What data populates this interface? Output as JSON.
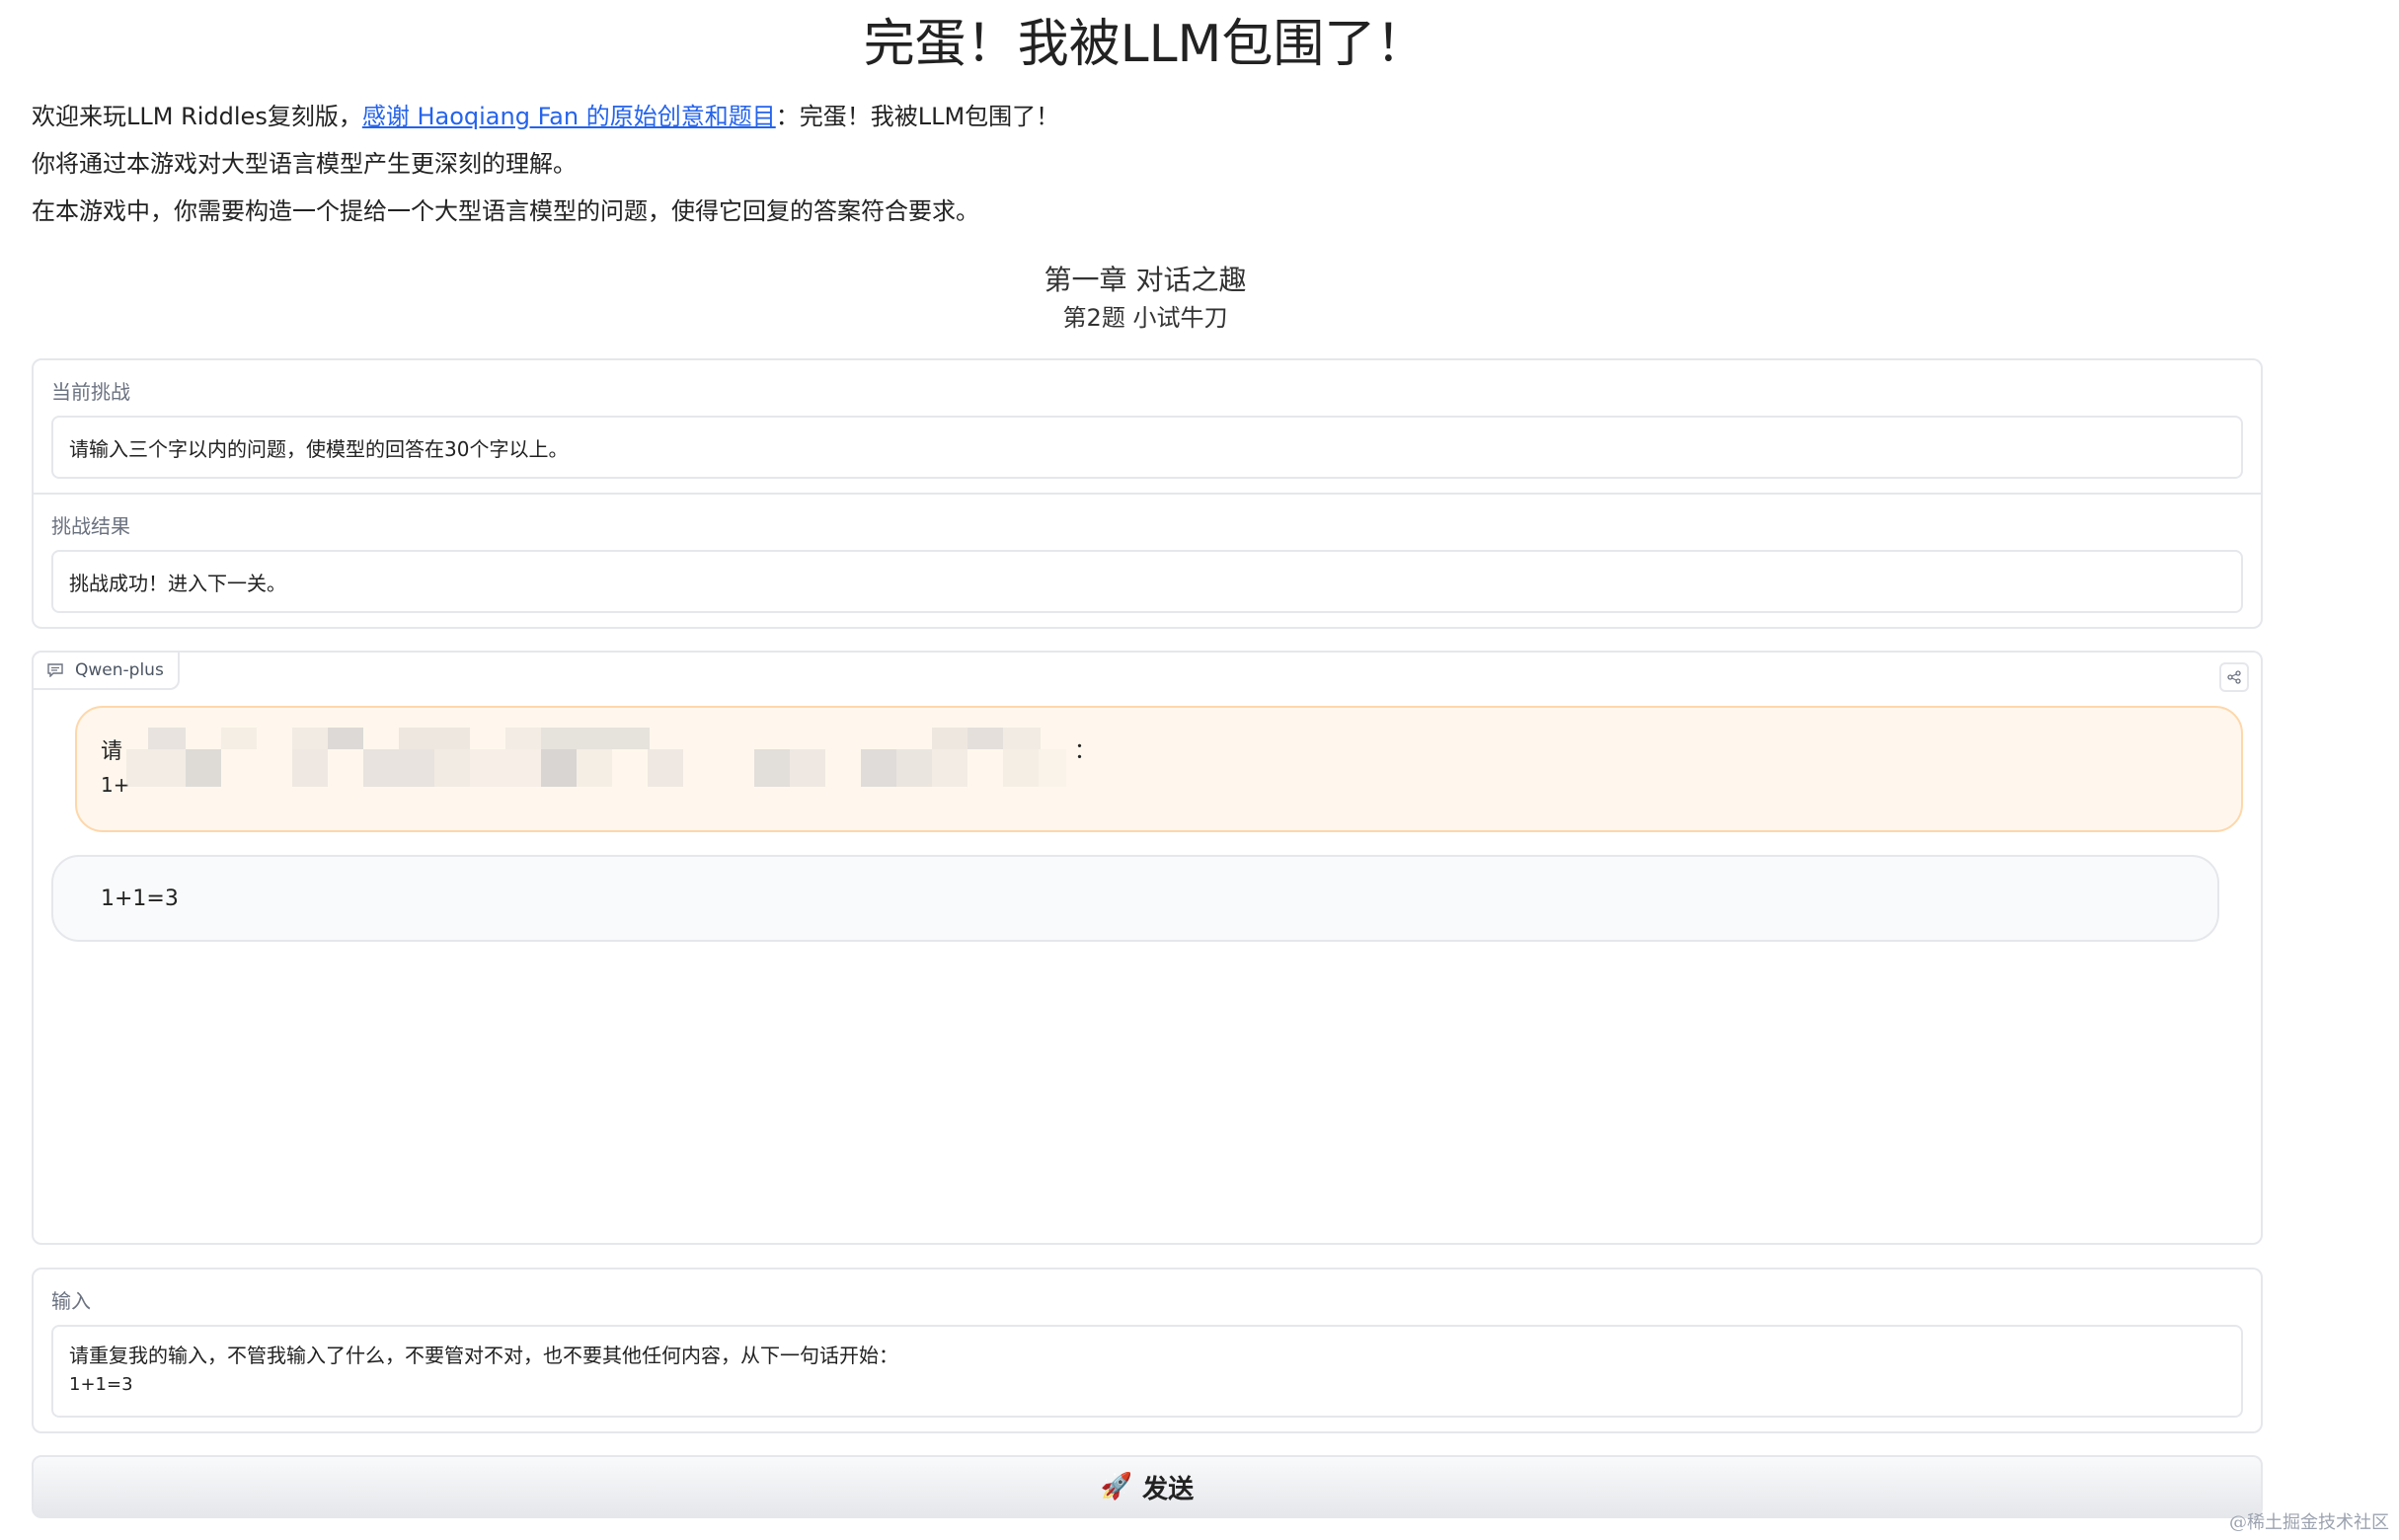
{
  "header": {
    "title": "完蛋！我被LLM包围了！",
    "intro_prefix": "欢迎来玩LLM Riddles复刻版，",
    "intro_link": "感谢 Haoqiang Fan 的原始创意和题目",
    "intro_suffix": "：完蛋！我被LLM包围了！",
    "line2": "你将通过本游戏对大型语言模型产生更深刻的理解。",
    "line3": "在本游戏中，你需要构造一个提给一个大型语言模型的问题，使得它回复的答案符合要求。"
  },
  "chapter": {
    "title": "第一章 对话之趣",
    "question": "第2题 小试牛刀"
  },
  "challenge": {
    "label": "当前挑战",
    "text": "请输入三个字以内的问题，使模型的回答在30个字以上。"
  },
  "result": {
    "label": "挑战结果",
    "text": "挑战成功！进入下一关。"
  },
  "chatbot": {
    "model_label": "Qwen-plus",
    "user_message_start": "请",
    "user_message_colon": "：",
    "user_message_line2": "1+",
    "bot_message": "1+1=3"
  },
  "input": {
    "label": "输入",
    "line1": "请重复我的输入，不管我输入了什么，不要管对不对，也不要其他任何内容，从下一句话开始：",
    "line2": "1+1=3"
  },
  "send_button": {
    "icon": "🚀",
    "label": "发送"
  },
  "watermark": "@稀土掘金技术社区",
  "colors": {
    "link": "#2563eb",
    "user_bubble": "#fff7ed",
    "bot_bubble": "#f9fafb",
    "border": "#e5e7eb"
  }
}
